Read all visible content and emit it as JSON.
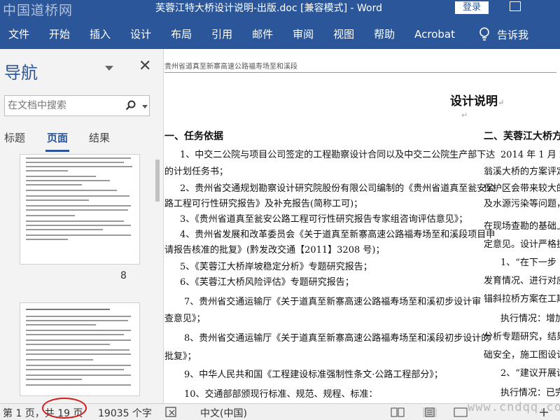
{
  "titlebar": {
    "watermark": "中国道桥网",
    "title": "芙蓉江特大桥设计说明-出版.doc [兼容模式] - Word",
    "login": "登录"
  },
  "ribbon": {
    "tabs": [
      "文件",
      "开始",
      "插入",
      "设计",
      "布局",
      "引用",
      "邮件",
      "审阅",
      "视图",
      "帮助",
      "Acrobat"
    ],
    "tell_me": "告诉我"
  },
  "nav": {
    "title": "导航",
    "search_placeholder": "在文档中搜索",
    "tabs": [
      "标题",
      "页面",
      "结果"
    ],
    "active_tab": "页面",
    "page_number": "8"
  },
  "doc": {
    "header": "贵州省道真至新寨高速公路福寿场至和溪段",
    "heading": "设计说明",
    "section1": "一、任务依据",
    "paragraphs": [
      "1、中交二公院与项目公司签定的工程勘察设计合同以及中交二公院生产部下达",
      "的计划任务书；",
      "2、贵州省交通规划勘察设计研究院股份有限公司编制的《贵州省道真至瓮安公",
      "路工程可行性研究报告》及补充报告(简称工可)；",
      "3、《贵州省道真至瓮安公路工程可行性研究报告专家组咨询评估意见》；",
      "4、贵州省发展和改革委员会《关于道真至新寨高速公路福寿场至和溪段项目申",
      "请报告核准的批复》(黔发改交通【2011】3208 号)；",
      "5、《芙蓉江大桥岸坡稳定分析》专题研究报告；",
      "6、《芙蓉江大桥风险评估》专题研究报告；",
      "7、贵州省交通运输厅《关于道真至新寨高速公路福寿场至和溪初步设计审",
      "查意见》；",
      "8、贵州省交通运输厅《关于道真至新寨高速公路福寿场至和溪段初步设计的",
      "批复》；",
      "9、中华人民共和国《工程建设标准强制性条文·公路工程部分》；",
      "10、交通部部颁现行标准、规范、规程、标准："
    ],
    "col2": [
      "二、芙蓉江大桥方",
      "2014 年 1 月 2 日",
      "翁溪大桥的方案评定",
      "保护区会带来较大的",
      "及水源污染等问题，",
      "在现场查勘的基础上",
      "定意见。设计严格执",
      "1、“在下一步",
      "发育情况、进行对应",
      "锚斜拉桥方案在工期",
      "执行情况：增加",
      "分析专题研究，结果",
      "础安全，施工图设计",
      "2、“建议开展设",
      "执行情况：已完"
    ]
  },
  "status": {
    "page": "第 1 页，共 19 页",
    "words": "19035 个字",
    "language": "中文(中国)",
    "watermark": "www.cndqq.com"
  }
}
